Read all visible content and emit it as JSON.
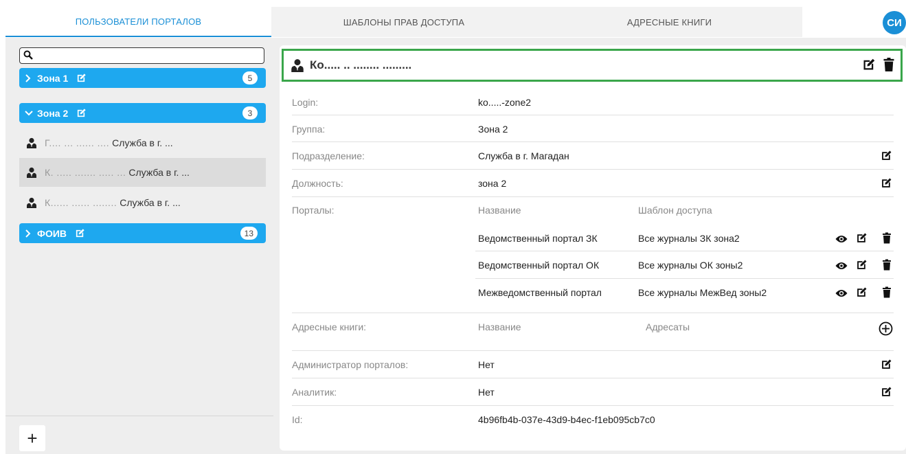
{
  "tabs": [
    {
      "label": "ПОЛЬЗОВАТЕЛИ ПОРТАЛОВ",
      "active": true
    },
    {
      "label": "ШАБЛОНЫ ПРАВ ДОСТУПА",
      "active": false
    },
    {
      "label": "АДРЕСНЫЕ КНИГИ",
      "active": false
    }
  ],
  "avatar": "СИ",
  "sidebar": {
    "search_value": "",
    "groups": [
      {
        "name": "Зона 1",
        "count": "5",
        "expanded": false
      },
      {
        "name": "Зона 2",
        "count": "3",
        "expanded": true
      },
      {
        "name": "ФОИВ",
        "count": "13",
        "expanded": false
      }
    ],
    "users": [
      {
        "name": "Г.... ... ...... ....",
        "service": "Служба в г. ..."
      },
      {
        "name": "К. ..... ....... ..... ...",
        "service": "Служба в г. ..."
      },
      {
        "name": "К...... ...... ........",
        "service": "Служба в г. ..."
      }
    ],
    "add_label": "+"
  },
  "detail": {
    "title": "Ко..... .. ........ .........",
    "login_label": "Login:",
    "login_value": "ko.....-zone2",
    "group_label": "Группа:",
    "group_value": "Зона 2",
    "division_label": "Подразделение:",
    "division_value": "Служба в г. Магадан",
    "position_label": "Должность:",
    "position_value": "зона 2",
    "portals_label": "Порталы:",
    "portals_col_name": "Название",
    "portals_col_template": "Шаблон доступа",
    "portals": [
      {
        "name": "Ведомственный портал ЗК",
        "template": "Все журналы ЗК зона2"
      },
      {
        "name": "Ведомственный портал ОК",
        "template": "Все журналы ОК зоны2"
      },
      {
        "name": "Межведомственный портал",
        "template": "Все журналы МежВед зоны2"
      }
    ],
    "books_label": "Адресные книги:",
    "books_col_name": "Название",
    "books_col_recipients": "Адресаты",
    "admin_label": "Администратор порталов:",
    "admin_value": "Нет",
    "analyst_label": "Аналитик:",
    "analyst_value": "Нет",
    "id_label": "Id:",
    "id_value": "4b96fb4b-037e-43d9-b4ec-f1eb095cb7c0"
  },
  "colors": {
    "accent": "#1ea8ef",
    "tab_active": "#1a8fd6",
    "header_border": "#3aa64b"
  }
}
